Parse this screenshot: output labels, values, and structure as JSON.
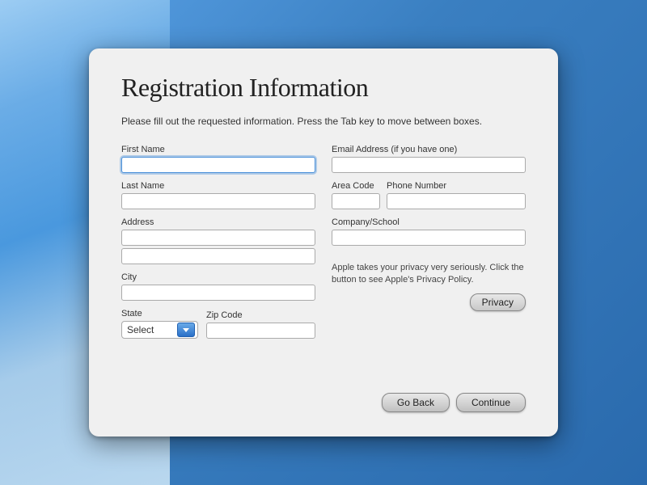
{
  "background": {
    "color": "#4a90d9"
  },
  "window": {
    "title": "Registration Information",
    "instructions": "Please fill out the requested information. Press the Tab key to move between boxes."
  },
  "form": {
    "left": {
      "first_name_label": "First Name",
      "first_name_value": "",
      "last_name_label": "Last Name",
      "last_name_value": "",
      "address_label": "Address",
      "address_line1_value": "",
      "address_line2_value": "",
      "city_label": "City",
      "city_value": "",
      "state_label": "State",
      "state_select_text": "Select",
      "zip_label": "Zip Code",
      "zip_value": ""
    },
    "right": {
      "email_label": "Email Address (if you have one)",
      "email_value": "",
      "area_code_label": "Area Code",
      "area_code_value": "",
      "phone_label": "Phone Number",
      "phone_value": "",
      "company_label": "Company/School",
      "company_value": "",
      "privacy_text": "Apple takes your privacy very seriously. Click the button to see Apple's Privacy Policy.",
      "privacy_button_label": "Privacy"
    }
  },
  "buttons": {
    "go_back": "Go Back",
    "continue": "Continue"
  },
  "icons": {
    "chevron_down": "chevron-down-icon",
    "dropdown_arrow": "dropdown-arrow-icon"
  }
}
